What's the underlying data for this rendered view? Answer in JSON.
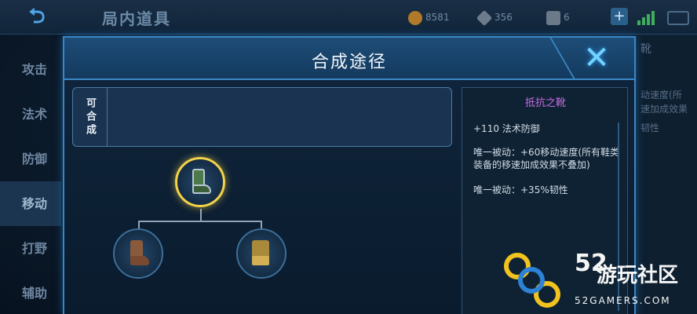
{
  "topbar": {
    "back_icon": "back-arrow-icon",
    "title": "局内道具",
    "gold_value": "8581",
    "diamond_value": "356",
    "coupon_value": "6",
    "plus_label": "+"
  },
  "side_menu": {
    "items": [
      {
        "label": "攻击",
        "active": false
      },
      {
        "label": "法术",
        "active": false
      },
      {
        "label": "防御",
        "active": false
      },
      {
        "label": "移动",
        "active": true
      },
      {
        "label": "打野",
        "active": false
      },
      {
        "label": "辅助",
        "active": false
      }
    ]
  },
  "right_peek": {
    "label": "靴",
    "lines": [
      "动速度(所",
      "速加成效果",
      "韧性"
    ]
  },
  "modal": {
    "title": "合成途径",
    "close_icon": "close-x-icon",
    "compose_label": "可合成"
  },
  "tree": {
    "root_item": "green-boots-icon",
    "children": [
      "brown-boots-icon",
      "gold-boots-icon"
    ]
  },
  "info": {
    "item_name": "抵抗之靴",
    "stat_line": "+110 法术防御",
    "passive_1": "唯一被动：+60移动速度(所有鞋类装备的移速加成效果不叠加)",
    "passive_2": "唯一被动：+35%韧性"
  },
  "watermark": {
    "number": "52",
    "site_name": "游玩社区",
    "url": "52GAMERS.COM"
  },
  "colors": {
    "accent_blue": "#3a86c4",
    "item_name_purple": "#c86de6",
    "selected_gold": "#f3d34a"
  }
}
